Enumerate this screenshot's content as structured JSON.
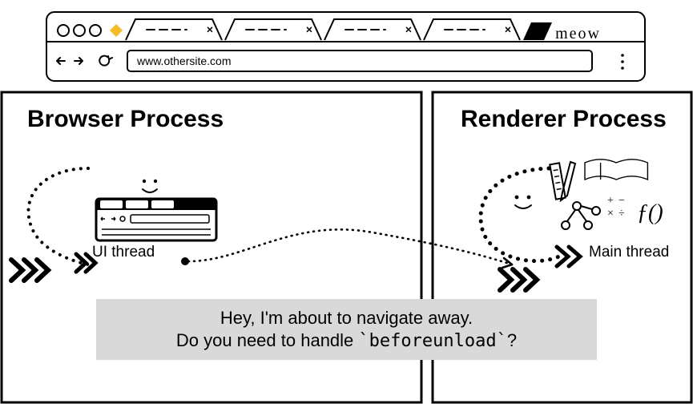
{
  "browser_window": {
    "brand": "meow",
    "url": "www.othersite.com"
  },
  "panels": {
    "browser_process": {
      "title": "Browser Process",
      "thread_label": "UI thread"
    },
    "renderer_process": {
      "title": "Renderer Process",
      "thread_label": "Main thread"
    }
  },
  "ipc_message": {
    "line1": "Hey, I'm about to navigate away.",
    "line2_prefix": "Do you need to handle ",
    "line2_code": "`beforeunload`",
    "line2_suffix": "?"
  },
  "diagram_semantics": {
    "type": "process-communication-diagram",
    "actors": [
      "Browser Process · UI thread",
      "Renderer Process · Main thread"
    ],
    "direction": "Browser → Renderer",
    "concept": "beforeunload IPC before navigation"
  }
}
